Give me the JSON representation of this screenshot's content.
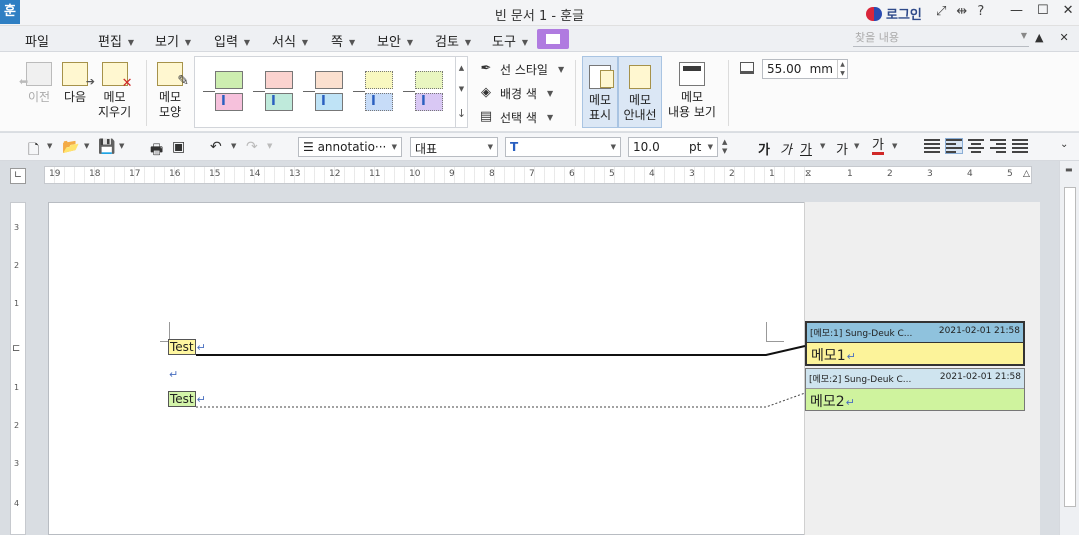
{
  "titlebar": {
    "app_logo": "훈",
    "title": "빈 문서 1 - 훈글",
    "login": "로그인",
    "icons": [
      "fullscreen-icon",
      "resize-icon",
      "help-icon"
    ],
    "help": "?",
    "minimize": "—",
    "maximize": "☐",
    "close": "✕"
  },
  "menu": {
    "items": [
      "파일",
      "편집",
      "보기",
      "입력",
      "서식",
      "쪽",
      "보안",
      "검토",
      "도구"
    ],
    "find_placeholder": "찾을 내용"
  },
  "ribbon": {
    "prev": "이전",
    "next": "다음",
    "erase": [
      "메모",
      "지우기"
    ],
    "shape": [
      "메모",
      "모양"
    ],
    "line_style": "선 스타일",
    "bg_color": "배경 색",
    "select_color": "선택 색",
    "show_memo": [
      "메모",
      "표시"
    ],
    "guide_line": [
      "메모",
      "안내선"
    ],
    "view_content": [
      "메모",
      "내용 보기"
    ],
    "width_value": "55.00",
    "width_unit": "mm",
    "shape_colors": [
      {
        "top": "#cdeeb0",
        "bottom": "#f6c1dc"
      },
      {
        "top": "#fbd3cf",
        "bottom": "#bfeadb"
      },
      {
        "top": "#fbe0cf",
        "bottom": "#bfe3f6"
      },
      {
        "top": "#f9f8c0",
        "bottom": "#c7dcf8"
      },
      {
        "top": "#e9f6c0",
        "bottom": "#d9c8f4"
      }
    ]
  },
  "format": {
    "style": "annotatio···",
    "font_lang": "대표",
    "font": "T",
    "size": "10.0",
    "size_unit": "pt",
    "bold": "가",
    "italic": "가",
    "underline": "가",
    "strike": "가",
    "color_text": "가"
  },
  "ruler": {
    "left_ticks": [
      "19",
      "18",
      "17",
      "16",
      "15",
      "14",
      "13",
      "12",
      "11",
      "10",
      "9",
      "8",
      "7",
      "6",
      "5",
      "4",
      "3",
      "2",
      "1"
    ],
    "right_ticks": [
      "1",
      "2",
      "3",
      "4",
      "5"
    ],
    "v_ticks": [
      "3",
      "2",
      "1",
      "1",
      "2",
      "3",
      "4"
    ]
  },
  "document": {
    "lines": [
      {
        "text": "Test",
        "mark": "↵"
      },
      {
        "text": "",
        "mark": "↵"
      },
      {
        "text": "Test",
        "mark": "↵"
      }
    ]
  },
  "memos": [
    {
      "header": "[메모:1] Sung-Deuk C...",
      "date": "2021-02-01 21:58",
      "body": "메모1",
      "mark": "↵"
    },
    {
      "header": "[메모:2] Sung-Deuk C...",
      "date": "2021-02-01 21:58",
      "body": "메모2",
      "mark": "↵"
    }
  ]
}
